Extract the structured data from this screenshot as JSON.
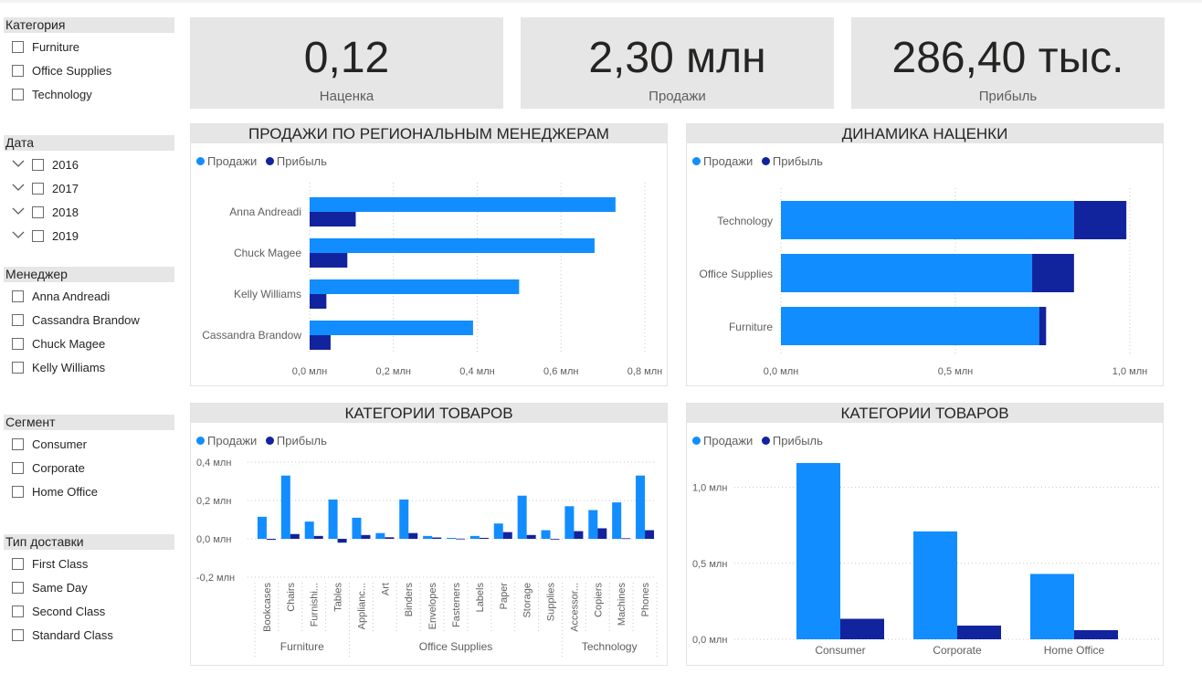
{
  "colors": {
    "sales": "#118dff",
    "profit": "#12239e",
    "grid": "#c8c8c8",
    "panel_title_bg": "#e6e6e6",
    "text": "#252423",
    "muted": "#605e5c"
  },
  "filters": {
    "category": {
      "title": "Категория",
      "items": [
        "Furniture",
        "Office Supplies",
        "Technology"
      ]
    },
    "date": {
      "title": "Дата",
      "items": [
        "2016",
        "2017",
        "2018",
        "2019"
      ]
    },
    "manager": {
      "title": "Менеджер",
      "items": [
        "Anna Andreadi",
        "Cassandra Brandow",
        "Chuck Magee",
        "Kelly Williams"
      ]
    },
    "segment": {
      "title": "Сегмент",
      "items": [
        "Consumer",
        "Corporate",
        "Home Office"
      ]
    },
    "shipping": {
      "title": "Тип доставки",
      "items": [
        "First Class",
        "Same Day",
        "Second Class",
        "Standard Class"
      ]
    }
  },
  "kpis": [
    {
      "value": "0,12",
      "label": "Наценка"
    },
    {
      "value": "2,30 млн",
      "label": "Продажи"
    },
    {
      "value": "286,40 тыс.",
      "label": "Прибыль"
    }
  ],
  "legend": {
    "sales": "Продажи",
    "profit": "Прибыль"
  },
  "chart_data": [
    {
      "type": "bar",
      "orientation": "horizontal",
      "title": "ПРОДАЖИ ПО РЕГИОНАЛЬНЫМ МЕНЕДЖЕРАМ",
      "categories": [
        "Anna Andreadi",
        "Chuck Magee",
        "Kelly Williams",
        "Cassandra Brandow"
      ],
      "series": [
        {
          "name": "Продажи",
          "values": [
            0.73,
            0.68,
            0.5,
            0.39
          ]
        },
        {
          "name": "Прибыль",
          "values": [
            0.11,
            0.09,
            0.04,
            0.05
          ]
        }
      ],
      "xlim": [
        0,
        0.8
      ],
      "xticks": [
        0,
        0.2,
        0.4,
        0.6,
        0.8
      ],
      "xtick_labels": [
        "0,0 млн",
        "0,2 млн",
        "0,4 млн",
        "0,6 млн",
        "0,8 млн"
      ],
      "legend": "top-left",
      "grid": true
    },
    {
      "type": "bar",
      "orientation": "horizontal",
      "stacked": true,
      "title": "ДИНАМИКА НАЦЕНКИ",
      "categories": [
        "Technology",
        "Office Supplies",
        "Furniture"
      ],
      "series": [
        {
          "name": "Продажи",
          "values": [
            0.84,
            0.72,
            0.74
          ]
        },
        {
          "name": "Прибыль",
          "values": [
            0.15,
            0.12,
            0.02
          ]
        }
      ],
      "xlim": [
        0,
        1.0
      ],
      "xticks": [
        0,
        0.5,
        1.0
      ],
      "xtick_labels": [
        "0,0 млн",
        "0,5 млн",
        "1,0 млн"
      ],
      "legend": "top-left",
      "grid": true
    },
    {
      "type": "bar",
      "title": "КАТЕГОРИИ ТОВАРОВ",
      "groups": [
        {
          "name": "Furniture",
          "categories": [
            "Bookcases",
            "Chairs",
            "Furnishi...",
            "Tables"
          ]
        },
        {
          "name": "Office Supplies",
          "categories": [
            "Applianc...",
            "Art",
            "Binders",
            "Envelopes",
            "Fasteners",
            "Labels",
            "Paper",
            "Storage",
            "Supplies"
          ]
        },
        {
          "name": "Technology",
          "categories": [
            "Accessor...",
            "Copiers",
            "Machines",
            "Phones"
          ]
        }
      ],
      "series": [
        {
          "name": "Продажи",
          "values": [
            0.115,
            0.33,
            0.09,
            0.205,
            0.11,
            0.03,
            0.205,
            0.015,
            0.005,
            0.015,
            0.08,
            0.225,
            0.045,
            0.17,
            0.15,
            0.19,
            0.33
          ]
        },
        {
          "name": "Прибыль",
          "values": [
            -0.005,
            0.025,
            0.015,
            -0.02,
            0.02,
            0.008,
            0.03,
            0.007,
            0.001,
            0.005,
            0.035,
            0.02,
            -0.001,
            0.04,
            0.055,
            0.003,
            0.045
          ]
        }
      ],
      "ylim": [
        -0.2,
        0.4
      ],
      "yticks": [
        -0.2,
        0,
        0.2,
        0.4
      ],
      "ytick_labels": [
        "-0,2 млн",
        "0,0 млн",
        "0,2 млн",
        "0,4 млн"
      ],
      "legend": "top-left",
      "grid": true
    },
    {
      "type": "bar",
      "title": "КАТЕГОРИИ ТОВАРОВ",
      "categories": [
        "Consumer",
        "Corporate",
        "Home Office"
      ],
      "series": [
        {
          "name": "Продажи",
          "values": [
            1.16,
            0.71,
            0.43
          ]
        },
        {
          "name": "Прибыль",
          "values": [
            0.135,
            0.09,
            0.06
          ]
        }
      ],
      "ylim": [
        0,
        1.25
      ],
      "yticks": [
        0,
        0.5,
        1.0
      ],
      "ytick_labels": [
        "0,0 млн",
        "0,5 млн",
        "1,0 млн"
      ],
      "legend": "top-left",
      "grid": true
    }
  ]
}
